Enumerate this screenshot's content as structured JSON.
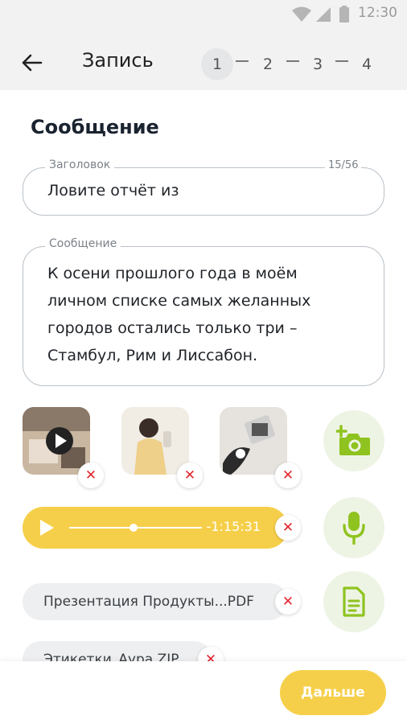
{
  "status_bar": {
    "time": "12:30"
  },
  "header": {
    "title": "Запись",
    "steps": [
      "1",
      "2",
      "3",
      "4"
    ],
    "active_step": 1
  },
  "section_title": "Сообщение",
  "title_field": {
    "label": "Заголовок",
    "counter": "15/56",
    "value": "Ловите отчёт из"
  },
  "message_field": {
    "label": "Сообщение",
    "lines": [
      "К осени прошлого года в моём",
      "личном списке самых желанных",
      "городов остались только три –",
      "Стамбул, Рим и Лиссабон."
    ]
  },
  "audio": {
    "time": "-1:15:31",
    "progress": 0.5
  },
  "files": [
    "Презентация Продукты...PDF",
    "Этикетки_Аура.ZIP"
  ],
  "buttons": {
    "next": "Дальше"
  },
  "icons": {
    "back": "arrow-left-icon",
    "remove": "close-icon",
    "add_photo": "add-camera-icon",
    "record": "microphone-icon",
    "attach_file": "document-icon",
    "play": "play-icon"
  },
  "colors": {
    "accent_yellow": "#f6cf4a",
    "accent_green": "#8fc31f",
    "remove_red": "#e3262f"
  }
}
